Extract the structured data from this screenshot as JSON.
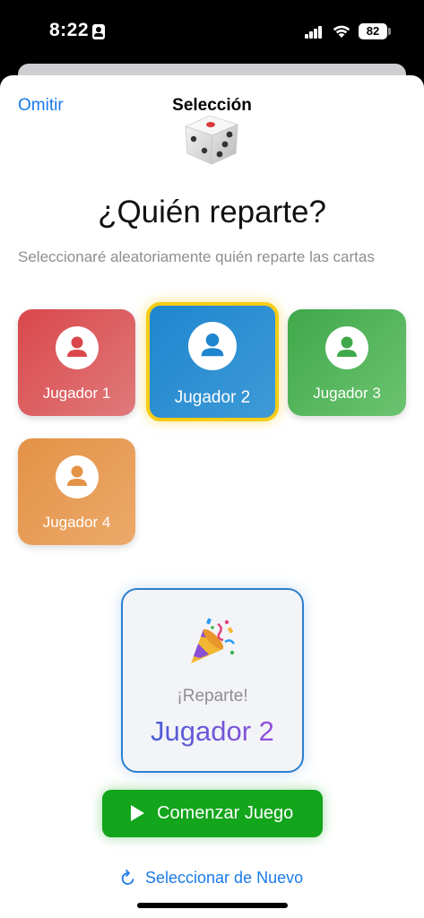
{
  "status_bar": {
    "time": "8:22",
    "battery": "82"
  },
  "header": {
    "skip_label": "Omitir",
    "title": "Selección"
  },
  "question": "¿Quién reparte?",
  "subtitle": "Seleccionaré aleatoriamente quién reparte las cartas",
  "players": [
    {
      "name": "Jugador 1",
      "color": "#d9474b"
    },
    {
      "name": "Jugador 2",
      "color": "#1e86cf",
      "selected": true
    },
    {
      "name": "Jugador 3",
      "color": "#3fa84a"
    },
    {
      "name": "Jugador 4",
      "color": "#e39246"
    }
  ],
  "result": {
    "label": "¡Reparte!",
    "winner": "Jugador 2",
    "icon": "party-popper-icon"
  },
  "start_button": {
    "label": "Comenzar Juego",
    "color": "#13a51c"
  },
  "reselect_button": {
    "label": "Seleccionar de Nuevo"
  },
  "accent_color": "#1a7be8",
  "selected_border_color": "#f6cc17"
}
